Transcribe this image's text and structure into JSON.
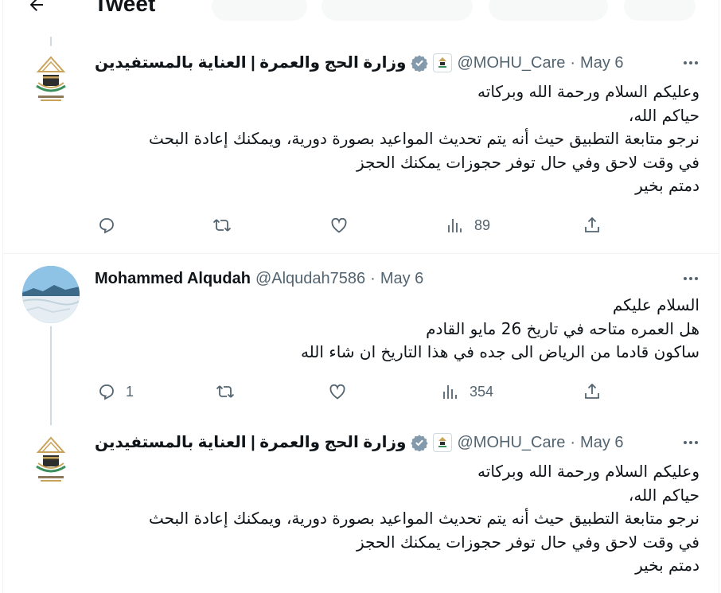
{
  "header": {
    "title": "Tweet"
  },
  "tweets": [
    {
      "name": "وزارة الحج والعمرة | العناية بالمستفيدين",
      "handle": "@MOHU_Care",
      "sep": "·",
      "date": "May 6",
      "lines": [
        "وعليكم السلام ورحمة الله وبركاته",
        "حياكم الله،",
        "نرجو متابعة التطبيق حيث أنه يتم تحديث المواعيد بصورة دورية، ويمكنك إعادة البحث",
        "في وقت لاحق وفي حال توفر حجوزات يمكنك الحجز",
        "دمتم بخير"
      ],
      "replies": "",
      "views": "89"
    },
    {
      "name": "Mohammed Alqudah",
      "handle": "@Alqudah7586",
      "sep": "·",
      "date": "May 6",
      "lines": [
        "السلام عليكم",
        "هل العمره متاحه في تاريخ 26 مايو القادم",
        "ساكون قادما من الرياض الى جده في هذا التاريخ ان شاء الله"
      ],
      "replies": "1",
      "views": "354"
    },
    {
      "name": "وزارة الحج والعمرة | العناية بالمستفيدين",
      "handle": "@MOHU_Care",
      "sep": "·",
      "date": "May 6",
      "lines": [
        "وعليكم السلام ورحمة الله وبركاته",
        "حياكم الله،",
        "نرجو متابعة التطبيق حيث أنه يتم تحديث المواعيد بصورة دورية، ويمكنك إعادة البحث",
        "في وقت لاحق وفي حال توفر حجوزات يمكنك الحجز",
        "دمتم بخير"
      ]
    }
  ],
  "colors": {
    "text": "#0f1419",
    "secondary": "#536471",
    "border": "#eff3f4",
    "thread": "#cfd9de",
    "verified": "#829aab"
  },
  "icons": [
    "back-arrow-icon",
    "more-icon",
    "verified-badge-icon",
    "affiliate-badge-icon",
    "reply-icon",
    "retweet-icon",
    "like-icon",
    "views-icon",
    "share-icon"
  ]
}
